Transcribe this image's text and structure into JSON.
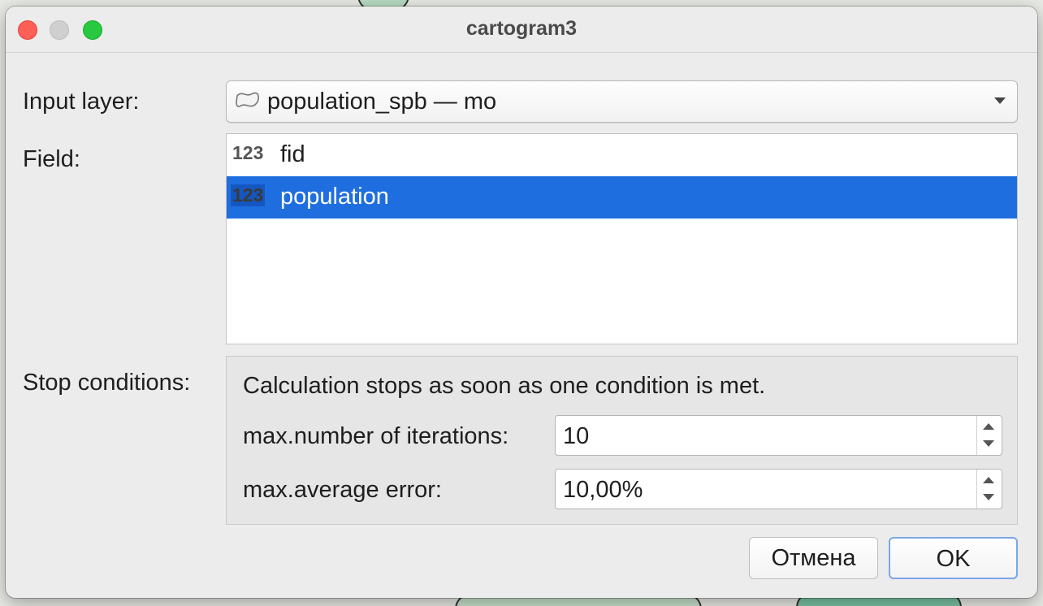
{
  "window": {
    "title": "cartogram3"
  },
  "form": {
    "input_layer_label": "Input layer:",
    "input_layer_value": "population_spb — mo",
    "field_label": "Field:",
    "fields": [
      {
        "type": "123",
        "name": "fid",
        "selected": false
      },
      {
        "type": "123",
        "name": "population",
        "selected": true
      }
    ],
    "stop_conditions_label": "Stop conditions:",
    "stop_note": "Calculation stops as soon as one condition is met.",
    "max_iterations_label": "max.number of iterations:",
    "max_iterations_value": "10",
    "max_error_label": "max.average error:",
    "max_error_value": "10,00%"
  },
  "buttons": {
    "cancel_label": "Отмена",
    "ok_label": "OK"
  }
}
